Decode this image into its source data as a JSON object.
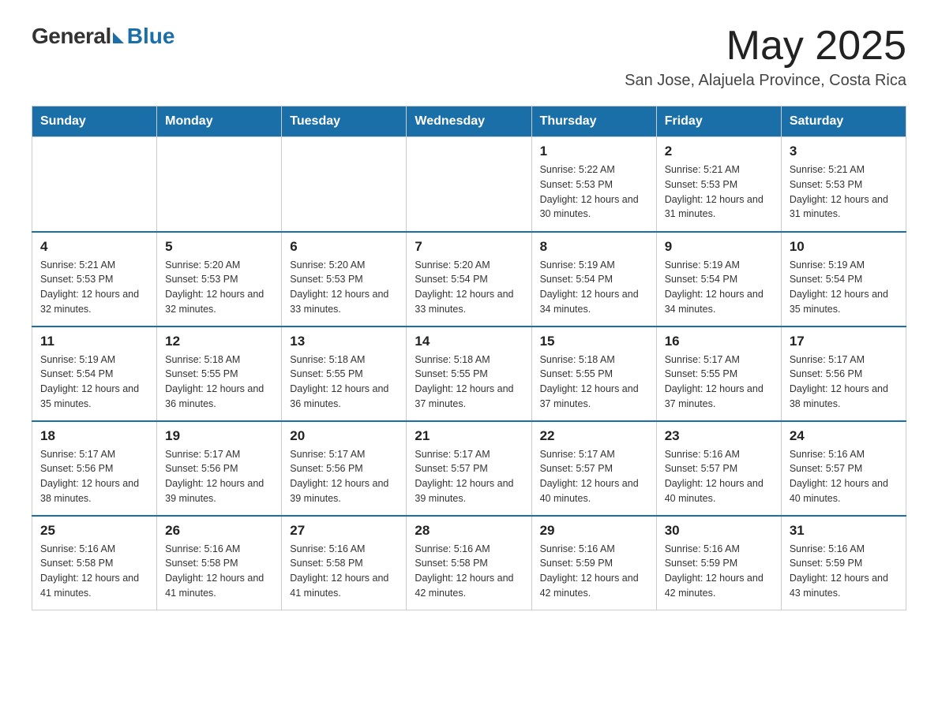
{
  "logo": {
    "general": "General",
    "blue": "Blue"
  },
  "header": {
    "month": "May 2025",
    "location": "San Jose, Alajuela Province, Costa Rica"
  },
  "days_of_week": [
    "Sunday",
    "Monday",
    "Tuesday",
    "Wednesday",
    "Thursday",
    "Friday",
    "Saturday"
  ],
  "weeks": [
    [
      {
        "day": "",
        "detail": ""
      },
      {
        "day": "",
        "detail": ""
      },
      {
        "day": "",
        "detail": ""
      },
      {
        "day": "",
        "detail": ""
      },
      {
        "day": "1",
        "detail": "Sunrise: 5:22 AM\nSunset: 5:53 PM\nDaylight: 12 hours and 30 minutes."
      },
      {
        "day": "2",
        "detail": "Sunrise: 5:21 AM\nSunset: 5:53 PM\nDaylight: 12 hours and 31 minutes."
      },
      {
        "day": "3",
        "detail": "Sunrise: 5:21 AM\nSunset: 5:53 PM\nDaylight: 12 hours and 31 minutes."
      }
    ],
    [
      {
        "day": "4",
        "detail": "Sunrise: 5:21 AM\nSunset: 5:53 PM\nDaylight: 12 hours and 32 minutes."
      },
      {
        "day": "5",
        "detail": "Sunrise: 5:20 AM\nSunset: 5:53 PM\nDaylight: 12 hours and 32 minutes."
      },
      {
        "day": "6",
        "detail": "Sunrise: 5:20 AM\nSunset: 5:53 PM\nDaylight: 12 hours and 33 minutes."
      },
      {
        "day": "7",
        "detail": "Sunrise: 5:20 AM\nSunset: 5:54 PM\nDaylight: 12 hours and 33 minutes."
      },
      {
        "day": "8",
        "detail": "Sunrise: 5:19 AM\nSunset: 5:54 PM\nDaylight: 12 hours and 34 minutes."
      },
      {
        "day": "9",
        "detail": "Sunrise: 5:19 AM\nSunset: 5:54 PM\nDaylight: 12 hours and 34 minutes."
      },
      {
        "day": "10",
        "detail": "Sunrise: 5:19 AM\nSunset: 5:54 PM\nDaylight: 12 hours and 35 minutes."
      }
    ],
    [
      {
        "day": "11",
        "detail": "Sunrise: 5:19 AM\nSunset: 5:54 PM\nDaylight: 12 hours and 35 minutes."
      },
      {
        "day": "12",
        "detail": "Sunrise: 5:18 AM\nSunset: 5:55 PM\nDaylight: 12 hours and 36 minutes."
      },
      {
        "day": "13",
        "detail": "Sunrise: 5:18 AM\nSunset: 5:55 PM\nDaylight: 12 hours and 36 minutes."
      },
      {
        "day": "14",
        "detail": "Sunrise: 5:18 AM\nSunset: 5:55 PM\nDaylight: 12 hours and 37 minutes."
      },
      {
        "day": "15",
        "detail": "Sunrise: 5:18 AM\nSunset: 5:55 PM\nDaylight: 12 hours and 37 minutes."
      },
      {
        "day": "16",
        "detail": "Sunrise: 5:17 AM\nSunset: 5:55 PM\nDaylight: 12 hours and 37 minutes."
      },
      {
        "day": "17",
        "detail": "Sunrise: 5:17 AM\nSunset: 5:56 PM\nDaylight: 12 hours and 38 minutes."
      }
    ],
    [
      {
        "day": "18",
        "detail": "Sunrise: 5:17 AM\nSunset: 5:56 PM\nDaylight: 12 hours and 38 minutes."
      },
      {
        "day": "19",
        "detail": "Sunrise: 5:17 AM\nSunset: 5:56 PM\nDaylight: 12 hours and 39 minutes."
      },
      {
        "day": "20",
        "detail": "Sunrise: 5:17 AM\nSunset: 5:56 PM\nDaylight: 12 hours and 39 minutes."
      },
      {
        "day": "21",
        "detail": "Sunrise: 5:17 AM\nSunset: 5:57 PM\nDaylight: 12 hours and 39 minutes."
      },
      {
        "day": "22",
        "detail": "Sunrise: 5:17 AM\nSunset: 5:57 PM\nDaylight: 12 hours and 40 minutes."
      },
      {
        "day": "23",
        "detail": "Sunrise: 5:16 AM\nSunset: 5:57 PM\nDaylight: 12 hours and 40 minutes."
      },
      {
        "day": "24",
        "detail": "Sunrise: 5:16 AM\nSunset: 5:57 PM\nDaylight: 12 hours and 40 minutes."
      }
    ],
    [
      {
        "day": "25",
        "detail": "Sunrise: 5:16 AM\nSunset: 5:58 PM\nDaylight: 12 hours and 41 minutes."
      },
      {
        "day": "26",
        "detail": "Sunrise: 5:16 AM\nSunset: 5:58 PM\nDaylight: 12 hours and 41 minutes."
      },
      {
        "day": "27",
        "detail": "Sunrise: 5:16 AM\nSunset: 5:58 PM\nDaylight: 12 hours and 41 minutes."
      },
      {
        "day": "28",
        "detail": "Sunrise: 5:16 AM\nSunset: 5:58 PM\nDaylight: 12 hours and 42 minutes."
      },
      {
        "day": "29",
        "detail": "Sunrise: 5:16 AM\nSunset: 5:59 PM\nDaylight: 12 hours and 42 minutes."
      },
      {
        "day": "30",
        "detail": "Sunrise: 5:16 AM\nSunset: 5:59 PM\nDaylight: 12 hours and 42 minutes."
      },
      {
        "day": "31",
        "detail": "Sunrise: 5:16 AM\nSunset: 5:59 PM\nDaylight: 12 hours and 43 minutes."
      }
    ]
  ]
}
